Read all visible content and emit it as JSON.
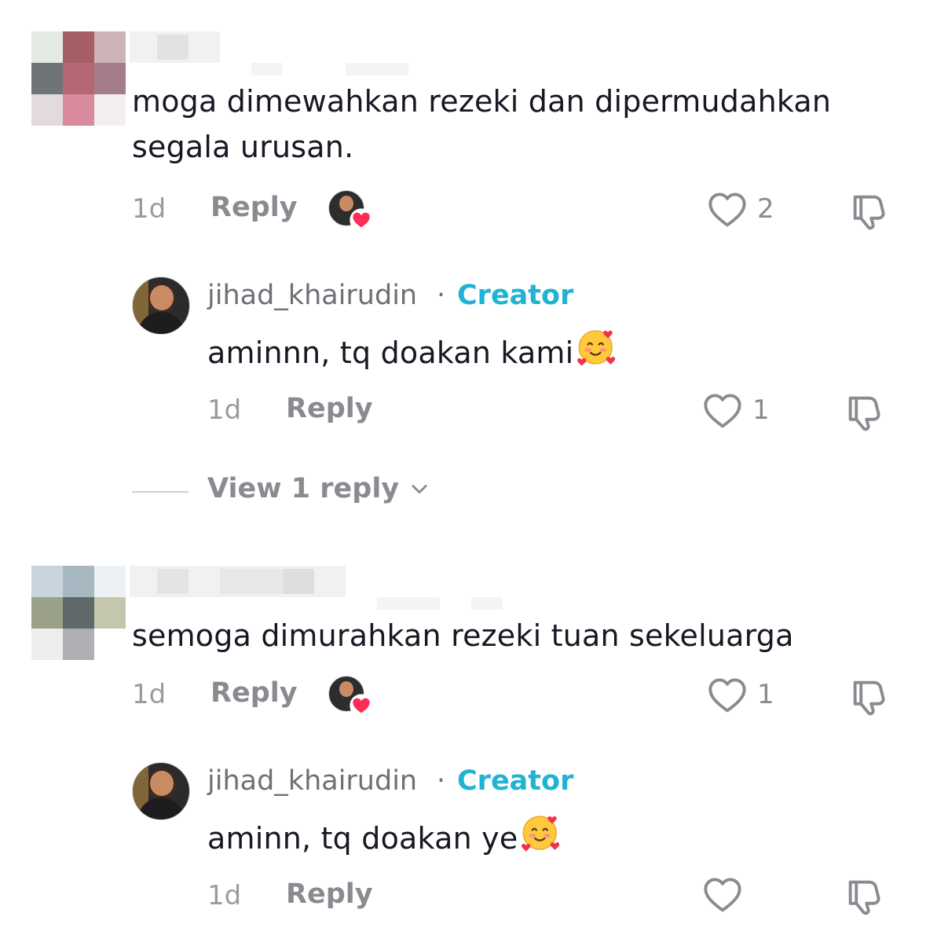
{
  "colors": {
    "creator_accent": "#20b3d4",
    "secondary_text": "#8a8b91",
    "primary_text": "#161823",
    "heart_badge": "#fe2c55"
  },
  "comments": [
    {
      "text_line1": "moga dimewahkan rezeki dan dipermudahkan",
      "text_line2": "segala urusan.",
      "time": "1d",
      "reply_label": "Reply",
      "likes": "2",
      "liked_by_creator": true,
      "view_replies": "View 1 reply",
      "replies": [
        {
          "username": "jihad_khairudin",
          "separator": "·",
          "badge": "Creator",
          "text": "aminnn, tq doakan kami",
          "emoji": "smiling-face-with-hearts",
          "time": "1d",
          "reply_label": "Reply",
          "likes": "1"
        }
      ]
    },
    {
      "text_line1": "semoga dimurahkan rezeki tuan sekeluarga",
      "time": "1d",
      "reply_label": "Reply",
      "likes": "1",
      "liked_by_creator": true,
      "replies": [
        {
          "username": "jihad_khairudin",
          "separator": "·",
          "badge": "Creator",
          "text": "aminn, tq doakan ye",
          "emoji": "smiling-face-with-hearts",
          "time": "1d",
          "reply_label": "Reply",
          "likes": ""
        }
      ]
    }
  ]
}
